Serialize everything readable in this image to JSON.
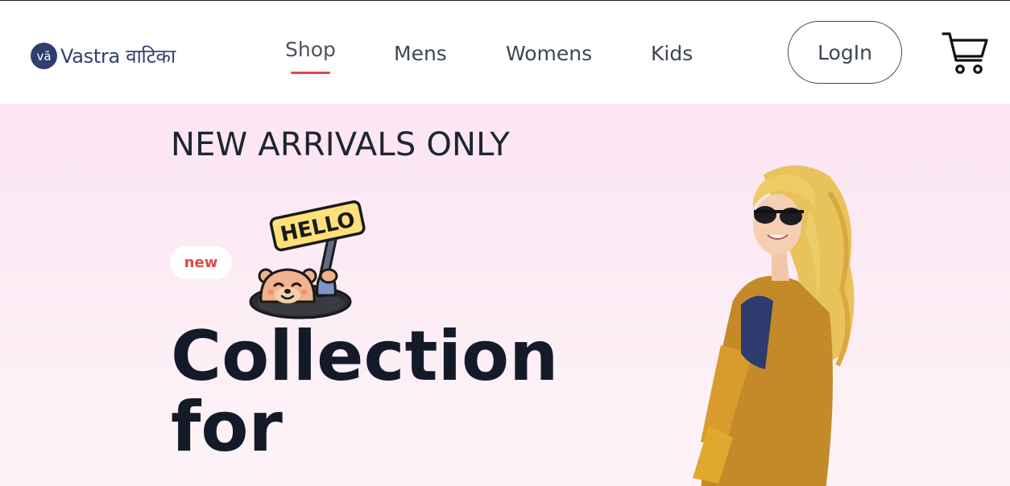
{
  "brand": {
    "badge": "vā",
    "name": "Vastra वाटिका"
  },
  "nav": {
    "items": [
      {
        "label": "Shop",
        "active": true
      },
      {
        "label": "Mens",
        "active": false
      },
      {
        "label": "Womens",
        "active": false
      },
      {
        "label": "Kids",
        "active": false
      }
    ]
  },
  "header": {
    "login_label": "LogIn",
    "cart_icon": "cart-icon"
  },
  "hero": {
    "eyebrow": "NEW ARRIVALS ONLY",
    "badge": "new",
    "sign_text": "HELLO",
    "headline_line1": "Collection",
    "headline_line2": "for"
  },
  "colors": {
    "accent": "#e04848",
    "brand": "#2e3f6e",
    "hero_bg": "#fbe5f2",
    "text_dark": "#141a28"
  }
}
